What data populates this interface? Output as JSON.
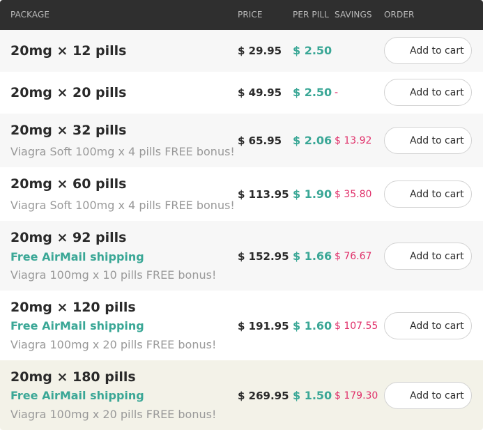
{
  "header": {
    "package": "PACKAGE",
    "price": "PRICE",
    "per_pill": "PER PILL",
    "savings": "SAVINGS",
    "order": "ORDER"
  },
  "rows": [
    {
      "title": "20mg × 12 pills",
      "price": "$ 29.95",
      "per_pill": "$ 2.50",
      "savings": "",
      "cart_label": "Add to cart"
    },
    {
      "title": "20mg × 20 pills",
      "price": "$ 49.95",
      "per_pill": "$ 2.50",
      "savings": "-",
      "cart_label": "Add to cart"
    },
    {
      "title": "20mg × 32 pills",
      "bonus": "Viagra Soft 100mg x 4 pills FREE bonus!",
      "price": "$ 65.95",
      "per_pill": "$ 2.06",
      "savings": "$ 13.92",
      "cart_label": "Add to cart"
    },
    {
      "title": "20mg × 60 pills",
      "bonus": "Viagra Soft 100mg x 4 pills FREE bonus!",
      "price": "$ 113.95",
      "per_pill": "$ 1.90",
      "savings": "$ 35.80",
      "cart_label": "Add to cart"
    },
    {
      "title": "20mg × 92 pills",
      "shipping": "Free AirMail shipping",
      "bonus": "Viagra 100mg x 10 pills FREE bonus!",
      "price": "$ 152.95",
      "per_pill": "$ 1.66",
      "savings": "$ 76.67",
      "cart_label": "Add to cart"
    },
    {
      "title": "20mg × 120 pills",
      "shipping": "Free AirMail shipping",
      "bonus": "Viagra 100mg x 20 pills FREE bonus!",
      "price": "$ 191.95",
      "per_pill": "$ 1.60",
      "savings": "$ 107.55",
      "cart_label": "Add to cart"
    },
    {
      "title": "20mg × 180 pills",
      "shipping": "Free AirMail shipping",
      "bonus": "Viagra 100mg x 20 pills FREE bonus!",
      "price": "$ 269.95",
      "per_pill": "$ 1.50",
      "savings": "$ 179.30",
      "cart_label": "Add to cart"
    }
  ],
  "colors": {
    "header_bg": "#2f2f2f",
    "accent_green": "#3aa796",
    "savings_pink": "#e0306a",
    "highlight_row": "#f3f2e8"
  }
}
